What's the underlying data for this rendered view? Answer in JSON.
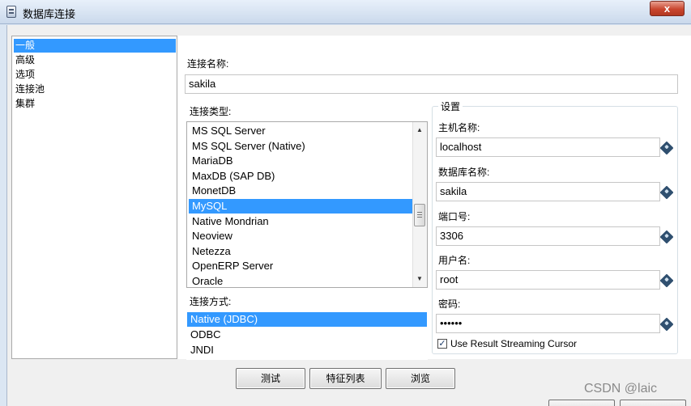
{
  "window": {
    "title": "数据库连接",
    "close_label": "x"
  },
  "nav": {
    "items": [
      {
        "label": "一般",
        "selected": true
      },
      {
        "label": "高级",
        "selected": false
      },
      {
        "label": "选项",
        "selected": false
      },
      {
        "label": "连接池",
        "selected": false
      },
      {
        "label": "集群",
        "selected": false
      }
    ]
  },
  "connection_name": {
    "label": "连接名称:",
    "value": "sakila"
  },
  "connection_type": {
    "label": "连接类型:",
    "items": [
      {
        "label": "MS SQL Server",
        "selected": false
      },
      {
        "label": "MS SQL Server (Native)",
        "selected": false
      },
      {
        "label": "MariaDB",
        "selected": false
      },
      {
        "label": "MaxDB (SAP DB)",
        "selected": false
      },
      {
        "label": "MonetDB",
        "selected": false
      },
      {
        "label": "MySQL",
        "selected": true
      },
      {
        "label": "Native Mondrian",
        "selected": false
      },
      {
        "label": "Neoview",
        "selected": false
      },
      {
        "label": "Netezza",
        "selected": false
      },
      {
        "label": "OpenERP Server",
        "selected": false
      },
      {
        "label": "Oracle",
        "selected": false
      }
    ]
  },
  "access_method": {
    "label": "连接方式:",
    "items": [
      {
        "label": "Native (JDBC)",
        "selected": true
      },
      {
        "label": "ODBC",
        "selected": false
      },
      {
        "label": "JNDI",
        "selected": false
      }
    ]
  },
  "settings": {
    "legend": "设置",
    "host_label": "主机名称:",
    "host_value": "localhost",
    "db_label": "数据库名称:",
    "db_value": "sakila",
    "port_label": "端口号:",
    "port_value": "3306",
    "user_label": "用户名:",
    "user_value": "root",
    "password_label": "密码:",
    "password_value": "••••••",
    "streaming_label": "Use Result Streaming Cursor",
    "streaming_checked": "✓"
  },
  "buttons": {
    "test": "测试",
    "feature_list": "特征列表",
    "explore": "浏览"
  },
  "watermark": "CSDN @laic"
}
